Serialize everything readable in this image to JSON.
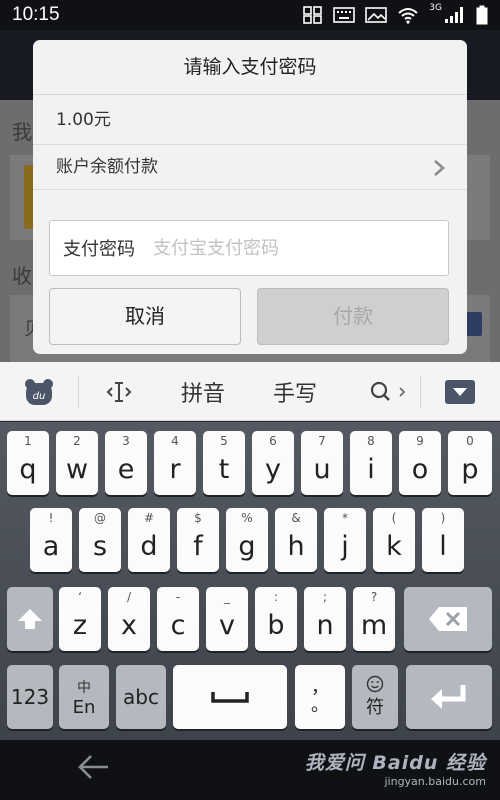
{
  "status_bar": {
    "time": "10:15",
    "network_type": "3G",
    "icons": [
      "grid-icon",
      "keyboard-icon",
      "image-icon",
      "wifi-icon",
      "signal-icon",
      "battery-icon"
    ]
  },
  "background_app": {
    "partial_text_1": "我",
    "partial_text_2": "收",
    "partial_text_3": "贝"
  },
  "dialog": {
    "title": "请输入支付密码",
    "amount": "1.00元",
    "payment_method": "账户余额付款",
    "password_label": "支付密码",
    "password_placeholder": "支付宝支付密码",
    "password_value": "",
    "cancel_label": "取消",
    "pay_label": "付款"
  },
  "keyboard_toolbar": {
    "pinyin": "拼音",
    "handwriting": "手写"
  },
  "keyboard": {
    "row1": [
      {
        "hint": "1",
        "ch": "q"
      },
      {
        "hint": "2",
        "ch": "w"
      },
      {
        "hint": "3",
        "ch": "e"
      },
      {
        "hint": "4",
        "ch": "r"
      },
      {
        "hint": "5",
        "ch": "t"
      },
      {
        "hint": "6",
        "ch": "y"
      },
      {
        "hint": "7",
        "ch": "u"
      },
      {
        "hint": "8",
        "ch": "i"
      },
      {
        "hint": "9",
        "ch": "o"
      },
      {
        "hint": "0",
        "ch": "p"
      }
    ],
    "row2": [
      {
        "hint": "!",
        "ch": "a"
      },
      {
        "hint": "@",
        "ch": "s"
      },
      {
        "hint": "#",
        "ch": "d"
      },
      {
        "hint": "$",
        "ch": "f"
      },
      {
        "hint": "%",
        "ch": "g"
      },
      {
        "hint": "&",
        "ch": "h"
      },
      {
        "hint": "*",
        "ch": "j"
      },
      {
        "hint": "(",
        "ch": "k"
      },
      {
        "hint": ")",
        "ch": "l"
      }
    ],
    "row3": [
      {
        "hint": "‘",
        "ch": "z"
      },
      {
        "hint": "/",
        "ch": "x"
      },
      {
        "hint": "-",
        "ch": "c"
      },
      {
        "hint": "_",
        "ch": "v"
      },
      {
        "hint": ":",
        "ch": "b"
      },
      {
        "hint": ";",
        "ch": "n"
      },
      {
        "hint": "?",
        "ch": "m"
      }
    ],
    "num_key": "123",
    "lang_key_top": "中",
    "lang_key_bottom": "En",
    "abc_key": "abc",
    "comma_top": "，",
    "period": "。",
    "symbol_key": "符"
  },
  "watermark": {
    "main": "我爱问 Baidu 经验",
    "sub": "jingyan.baidu.com"
  }
}
